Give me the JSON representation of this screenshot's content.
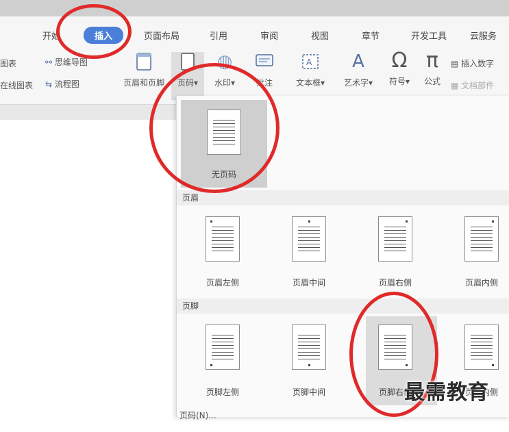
{
  "tabs": [
    "开始",
    "插入",
    "页面布局",
    "引用",
    "审阅",
    "视图",
    "章节",
    "开发工具",
    "云服务"
  ],
  "active_tab": "插入",
  "toolbar": {
    "left_top": "图表",
    "left_bottom": "在线图表",
    "mindmap": "思维导图",
    "flowchart": "流程图",
    "header_footer": "页眉和页脚",
    "page_number": "页码",
    "watermark": "水印",
    "comment": "批注",
    "textbox": "文本框",
    "wordart": "艺术字",
    "symbol": "符号",
    "formula": "公式",
    "insert_number": "插入数字",
    "doc_part": "文档部件"
  },
  "dropdown": {
    "no_page": "无页码",
    "header_section": "页眉",
    "header_items": [
      "页眉左侧",
      "页眉中间",
      "页眉右侧",
      "页眉内侧"
    ],
    "footer_section": "页脚",
    "footer_items": [
      "页脚左侧",
      "页脚中间",
      "页脚右侧",
      "页脚内侧"
    ],
    "bottom_item": "页码(N)..."
  },
  "watermark_text": "最需教育",
  "colors": {
    "accent": "#4a7fd9",
    "annotation": "#e02a2a"
  }
}
